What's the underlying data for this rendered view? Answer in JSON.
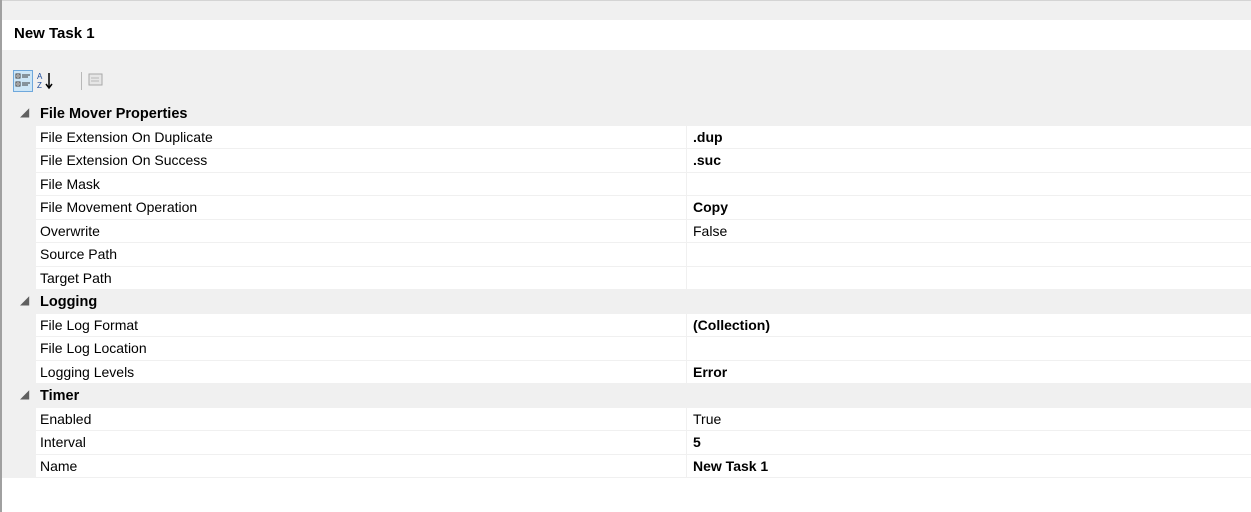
{
  "panel": {
    "title": "New Task 1"
  },
  "toolbar": {
    "buttons": [
      {
        "icon": "categorized-icon",
        "pressed": true
      },
      {
        "icon": "alphabetical-sort-icon",
        "pressed": false
      },
      {
        "icon": "property-pages-icon",
        "enabled": false
      }
    ]
  },
  "grid": {
    "expander_glyph": "◢",
    "categories": [
      {
        "label": "File Mover Properties",
        "expanded": true,
        "properties": [
          {
            "name": "File Extension On Duplicate",
            "value": ".dup",
            "modified": true
          },
          {
            "name": "File Extension On Success",
            "value": ".suc",
            "modified": true
          },
          {
            "name": "File Mask",
            "value": "",
            "modified": false
          },
          {
            "name": "File Movement Operation",
            "value": "Copy",
            "modified": true
          },
          {
            "name": "Overwrite",
            "value": "False",
            "modified": false
          },
          {
            "name": "Source Path",
            "value": "",
            "modified": false
          },
          {
            "name": "Target Path",
            "value": "",
            "modified": false
          }
        ]
      },
      {
        "label": "Logging",
        "expanded": true,
        "properties": [
          {
            "name": "File Log Format",
            "value": "(Collection)",
            "modified": true
          },
          {
            "name": "File Log Location",
            "value": "",
            "modified": false
          },
          {
            "name": "Logging Levels",
            "value": "Error",
            "modified": true
          }
        ]
      },
      {
        "label": "Timer",
        "expanded": true,
        "properties": [
          {
            "name": "Enabled",
            "value": "True",
            "modified": false
          },
          {
            "name": "Interval",
            "value": "5",
            "modified": true
          },
          {
            "name": "Name",
            "value": "New Task 1",
            "modified": true
          }
        ]
      }
    ]
  }
}
